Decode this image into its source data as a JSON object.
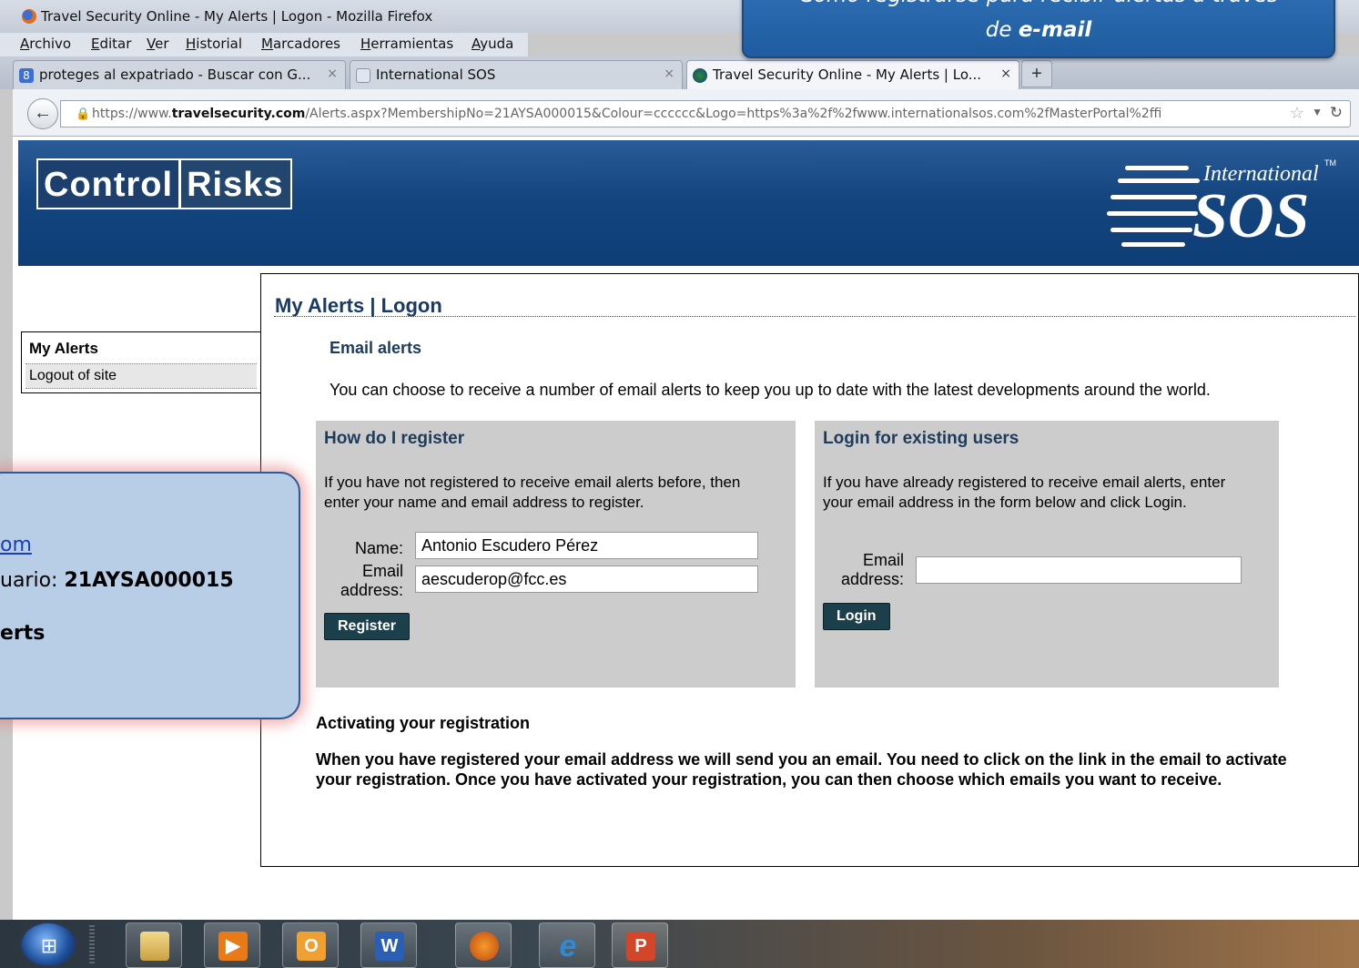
{
  "browser": {
    "window_title": "Travel Security Online - My Alerts | Logon - Mozilla Firefox",
    "menu": [
      "Archivo",
      "Editar",
      "Ver",
      "Historial",
      "Marcadores",
      "Herramientas",
      "Ayuda"
    ],
    "tabs": [
      {
        "label": "proteges al expatriado - Buscar con G...",
        "favicon": "google-icon"
      },
      {
        "label": "International SOS",
        "favicon": "page-icon"
      },
      {
        "label": "Travel Security Online - My Alerts | Lo...",
        "favicon": "globe-icon"
      }
    ],
    "url_domain": "https://www.travelsecurity.com",
    "url_host_bold": "travelsecurity.com",
    "url_rest": "/Alerts.aspx?MembershipNo=21AYSA000015&Colour=cccccc&Logo=https%3a%2f%2fwww.internationalsos.com%2fMasterPortal%2ffi"
  },
  "page": {
    "logo_left_a": "Control",
    "logo_left_b": "Risks",
    "logo_right_small": "International",
    "logo_right_tm": "TM",
    "logo_right_big": "SOS",
    "sidebar": {
      "title": "My Alerts",
      "link": "Logout of site"
    },
    "heading": "My Alerts | Logon",
    "subheading": "Email alerts",
    "intro": "You can choose to receive a number of email alerts to keep you up to date with the latest developments around the world.",
    "register": {
      "title": "How do I register",
      "text": "If you have not registered to receive email alerts before, then enter your name and email address to register.",
      "name_label": "Name:",
      "email_label_1": "Email",
      "email_label_2": "address:",
      "name_value": "Antonio Escudero Pérez",
      "email_value": "aescuderop@fcc.es",
      "button": "Register"
    },
    "login": {
      "title": "Login for existing users",
      "text": "If you have already registered to receive email alerts, enter your email address in the form below and click Login.",
      "email_label_1": "Email",
      "email_label_2": "address:",
      "email_value": "",
      "button": "Login"
    },
    "activating": {
      "title": "Activating your registration",
      "text": "When you have registered your email address we will send you an email. You need to click on the link in the email to activate your registration. Once you have activated your registration, you can then choose which emails you want to receive."
    }
  },
  "overlays": {
    "top_callout_line1": "Cómo registrarse para recibir alertas a través",
    "top_callout_line2_prefix": "de ",
    "top_callout_line2_bold": "e-mail",
    "left_callout_link": "om",
    "left_callout_user_prefix": "uario: ",
    "left_callout_user_value": "21AYSA000015",
    "left_callout_alerts": "erts"
  },
  "taskbar": {
    "icons": [
      "start-orb-icon",
      "explorer-icon",
      "media-player-icon",
      "outlook-icon",
      "word-icon",
      "firefox-icon",
      "internet-explorer-icon",
      "powerpoint-icon"
    ]
  }
}
